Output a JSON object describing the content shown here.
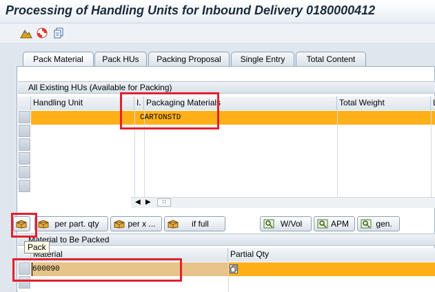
{
  "window": {
    "title": "Processing of Handling Units for Inbound Delivery 0180000412"
  },
  "toolbar": {
    "icons": [
      "mountain-icon",
      "lifebuoy-icon",
      "copy-icon"
    ]
  },
  "tabs": [
    {
      "label": "Pack Material",
      "active": true
    },
    {
      "label": "Pack HUs",
      "active": false
    },
    {
      "label": "Packing Proposal",
      "active": false
    },
    {
      "label": "Single Entry",
      "active": false
    },
    {
      "label": "Total Content",
      "active": false
    }
  ],
  "hus_section": {
    "title": "All Existing HUs (Available for Packing)",
    "columns": [
      "Handling Unit",
      "I.",
      "Packaging Materials",
      "Total Weight",
      "L"
    ],
    "rows": [
      {
        "handling_unit": "",
        "indicator": "",
        "packaging_material": "CARTONSTD",
        "total_weight": ""
      }
    ]
  },
  "buttons": [
    {
      "label": "",
      "icon": "pack-icon"
    },
    {
      "label": "per part. qty",
      "icon": "pack-icon"
    },
    {
      "label": "per x ...",
      "icon": "pack-icon"
    },
    {
      "label": "if full",
      "icon": "pack-icon"
    },
    {
      "label": "W/Vol",
      "icon": "search-icon"
    },
    {
      "label": "APM",
      "icon": "search-icon"
    },
    {
      "label": "gen.",
      "icon": "search-icon"
    }
  ],
  "tooltip": {
    "text": "Pack"
  },
  "material_section": {
    "title": "Material to Be Packed",
    "columns": [
      "Material",
      "Partial Qty"
    ],
    "rows": [
      {
        "material": "600090",
        "partial_qty": ""
      }
    ]
  },
  "colors": {
    "highlight_row": "#ffb019",
    "selected_cell": "#e7c48a",
    "annotation": "#e4202b"
  }
}
